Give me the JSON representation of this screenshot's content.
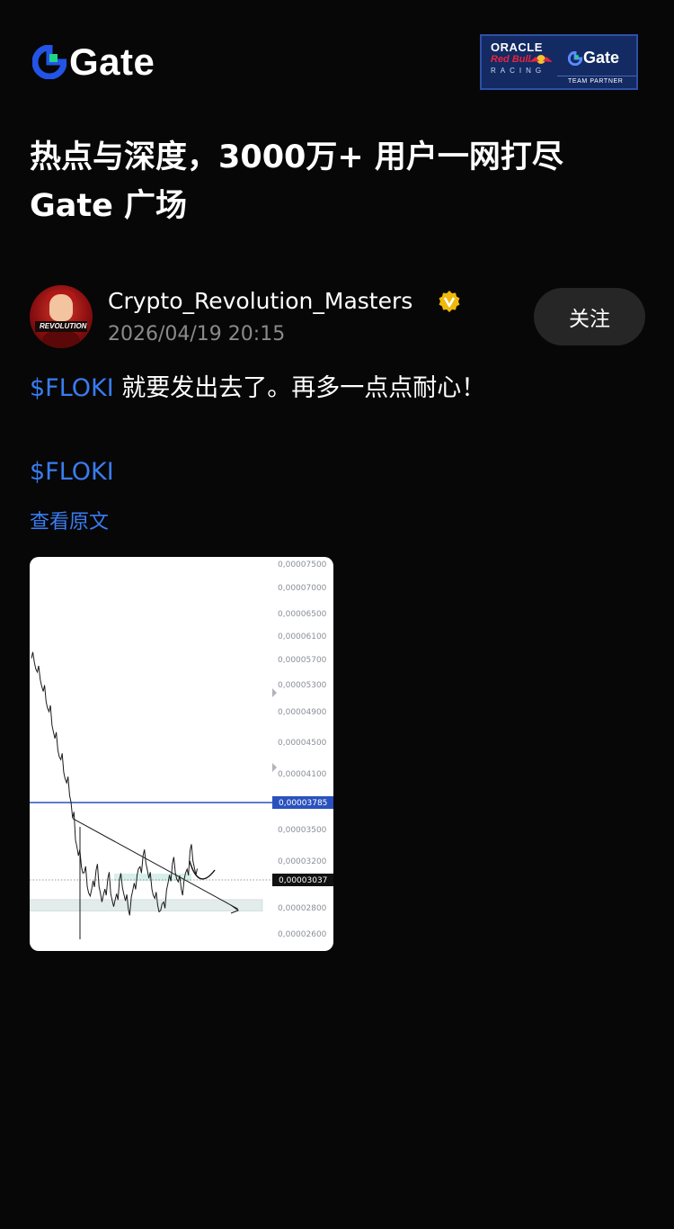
{
  "header": {
    "logo_text": "Gate",
    "partner_badge": {
      "line1": "ORACLE",
      "line2": "Red Bull",
      "line3": "RACING",
      "gate_text": "Gate",
      "tagline": "TEAM PARTNER"
    }
  },
  "headline": {
    "line1": "热点与深度，3000万+ 用户一网打尽",
    "line2": "Gate 广场"
  },
  "post": {
    "author": "Crypto_Revolution_Masters",
    "avatar_text": "REVOLUTION",
    "timestamp": "2026/04/19 20:15",
    "follow_label": "关注",
    "ticker": "$FLOKI",
    "text": " 就要发出去了。再多一点点耐心！",
    "tag": "$FLOKI",
    "view_original": "查看原文"
  },
  "chart_data": {
    "type": "line",
    "title": "",
    "xlabel": "",
    "ylabel": "",
    "ylim": [
      2.6e-05,
      7.5e-05
    ],
    "y_ticks": [
      "0,00007500",
      "0,00007000",
      "0,00006500",
      "0,00006100",
      "0,00005700",
      "0,00005300",
      "0,00004900",
      "0,00004500",
      "0,00004100",
      "0,00003500",
      "0,00003200",
      "0,00002800",
      "0,00002600"
    ],
    "y_tick_values": [
      7.5e-05,
      7e-05,
      6.5e-05,
      6.1e-05,
      5.7e-05,
      5.3e-05,
      4.9e-05,
      4.5e-05,
      4.1e-05,
      3.5e-05,
      3.2e-05,
      2.8e-05,
      2.6e-05
    ],
    "price_labels": [
      {
        "text": "0,00003785",
        "value": 3.785e-05,
        "color": "#2a52be"
      },
      {
        "text": "0,00003037",
        "value": 3.037e-05,
        "color": "#111111"
      }
    ],
    "series": [
      {
        "values": [
          5.72e-05,
          5.65e-05,
          5.5e-05,
          5.38e-05,
          5.2e-05,
          5.05e-05,
          4.9e-05,
          4.72e-05,
          4.55e-05,
          4.4e-05,
          4.28e-05,
          4.12e-05,
          4e-05,
          3.86e-05,
          3.62e-05,
          3.4e-05,
          3.25e-05,
          3.15e-05,
          3.1e-05,
          2.98e-05,
          2.9e-05,
          3.03e-05,
          3.12e-05,
          2.98e-05,
          2.85e-05,
          2.96e-05,
          3.05e-05,
          2.92e-05,
          2.81e-05,
          2.92e-05,
          3.04e-05,
          2.97e-05,
          2.86e-05,
          2.79e-05,
          2.89e-05,
          3.01e-05,
          3.08e-05,
          3.15e-05,
          3.25e-05,
          3.18e-05,
          3.05e-05,
          2.96e-05,
          2.88e-05,
          2.82e-05,
          2.78e-05,
          2.85e-05,
          2.95e-05,
          3.08e-05,
          3.18e-05,
          3.1e-05,
          3.02e-05,
          2.96e-05,
          3.04e-05,
          3.13e-05,
          3.3e-05,
          3.2e-05,
          3.08e-05
        ]
      }
    ],
    "trendline": {
      "from": [
        0,
        3.73e-05
      ],
      "to": [
        1,
        2.79e-05
      ]
    },
    "support_zone": [
      2.775e-05,
      2.87e-05
    ],
    "grid": false
  }
}
